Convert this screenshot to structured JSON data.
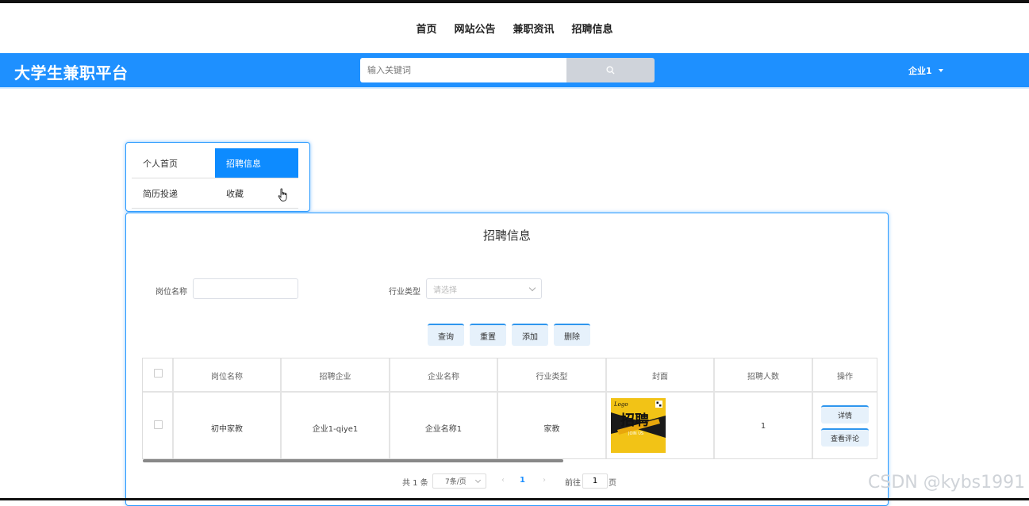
{
  "topnav": {
    "items": [
      "首页",
      "网站公告",
      "兼职资讯",
      "招聘信息"
    ]
  },
  "header": {
    "brand": "大学生兼职平台",
    "search_placeholder": "输入关键词",
    "search_icon": "search-icon",
    "user_label": "企业1"
  },
  "subnav": {
    "items": [
      {
        "label": "个人首页",
        "active": false
      },
      {
        "label": "招聘信息",
        "active": true
      },
      {
        "label": "简历投递",
        "active": false
      },
      {
        "label": "收藏",
        "active": false
      }
    ]
  },
  "panel": {
    "title": "招聘信息",
    "filters": {
      "job_name_label": "岗位名称",
      "job_name_value": "",
      "industry_label": "行业类型",
      "industry_placeholder": "请选择"
    },
    "actions": [
      "查询",
      "重置",
      "添加",
      "删除"
    ],
    "table": {
      "columns": [
        "岗位名称",
        "招聘企业",
        "企业名称",
        "行业类型",
        "封面",
        "招聘人数",
        "操作"
      ],
      "rows": [
        {
          "job_name": "初中家教",
          "recruit_company": "企业1-qiye1",
          "company_name": "企业名称1",
          "industry": "家教",
          "cover": {
            "logo_text": "Logo",
            "title": "招聘",
            "sub": "JOIN US"
          },
          "headcount": "1",
          "ops": [
            "详情",
            "查看评论"
          ]
        }
      ]
    },
    "pagination": {
      "total": "共 1 条",
      "page_size": "7条/页",
      "current_page": "1",
      "goto_label": "前往",
      "goto_value": "1",
      "page_suffix": "页"
    }
  },
  "watermark": "CSDN @kybs1991",
  "colors": {
    "primary": "#1e90ff",
    "header_bg": "#1e90ff",
    "cover_accent": "#f2c316"
  }
}
